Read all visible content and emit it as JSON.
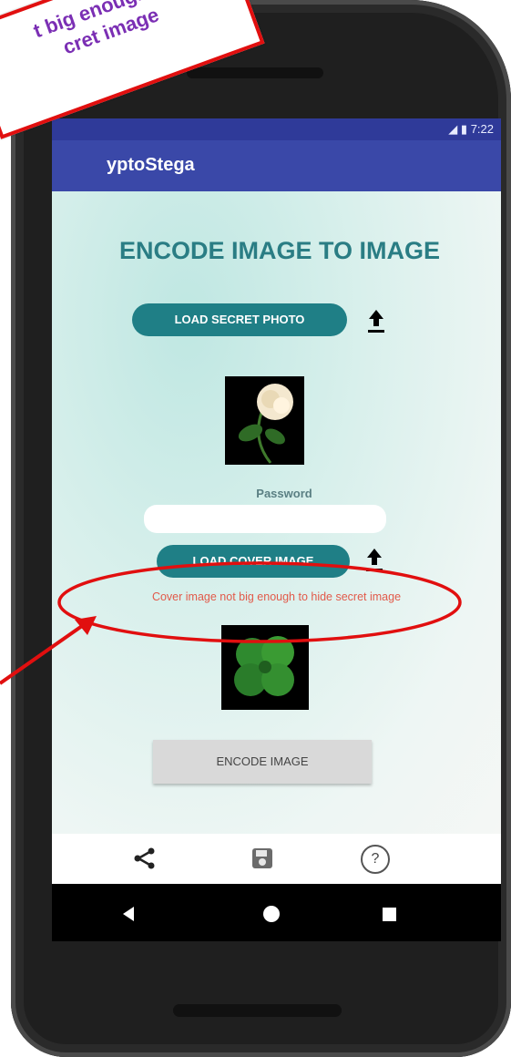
{
  "status_bar": {
    "time": "7:22",
    "icons": "signal-icon battery-icon"
  },
  "app_bar": {
    "title": "yptoStega"
  },
  "main": {
    "heading": "ENCODE IMAGE TO IMAGE",
    "load_secret_label": "LOAD SECRET PHOTO",
    "password_label": "Password",
    "password_value": "",
    "load_cover_label": "LOAD COVER IMAGE",
    "error_message": "Cover image not big enough to hide secret image",
    "encode_label": "ENCODE IMAGE"
  },
  "bottom_nav": {
    "icons": [
      "share-icon",
      "save-icon",
      "help-icon"
    ],
    "help_glyph": "?"
  },
  "system_nav": {
    "icons": [
      "back-icon",
      "home-icon",
      "recents-icon"
    ]
  },
  "annotation": {
    "callout_line1": "t big enough to",
    "callout_line2": "cret image",
    "highlight_color": "#e10f0f",
    "callout_text_color": "#7b2fb4"
  },
  "colors": {
    "status_bar": "#2f3a99",
    "app_bar": "#3a48a8",
    "accent": "#1f7f86",
    "heading": "#2a7d84",
    "error": "#e25a4a"
  }
}
